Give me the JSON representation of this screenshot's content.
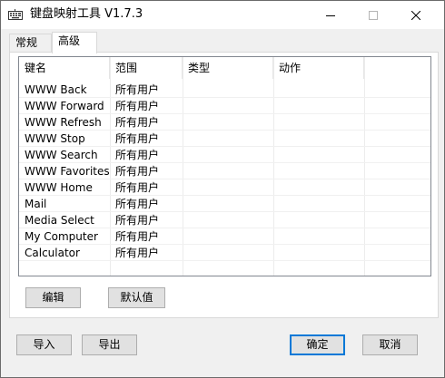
{
  "window": {
    "title": "键盘映射工具 V1.7.3"
  },
  "titlebar": {
    "icons": [
      "keyboard-icon",
      "minimize-icon",
      "maximize-icon",
      "close-icon"
    ]
  },
  "tabs": [
    {
      "label": "常规",
      "active": false
    },
    {
      "label": "高级",
      "active": true
    }
  ],
  "list": {
    "columns": [
      "键名",
      "范围",
      "类型",
      "动作"
    ],
    "rows": [
      {
        "key": "WWW Back",
        "scope": "所有用户",
        "type": "",
        "action": ""
      },
      {
        "key": "WWW Forward",
        "scope": "所有用户",
        "type": "",
        "action": ""
      },
      {
        "key": "WWW Refresh",
        "scope": "所有用户",
        "type": "",
        "action": ""
      },
      {
        "key": "WWW Stop",
        "scope": "所有用户",
        "type": "",
        "action": ""
      },
      {
        "key": "WWW Search",
        "scope": "所有用户",
        "type": "",
        "action": ""
      },
      {
        "key": "WWW Favorites",
        "scope": "所有用户",
        "type": "",
        "action": ""
      },
      {
        "key": "WWW Home",
        "scope": "所有用户",
        "type": "",
        "action": ""
      },
      {
        "key": "Mail",
        "scope": "所有用户",
        "type": "",
        "action": ""
      },
      {
        "key": "Media Select",
        "scope": "所有用户",
        "type": "",
        "action": ""
      },
      {
        "key": "My Computer",
        "scope": "所有用户",
        "type": "",
        "action": ""
      },
      {
        "key": "Calculator",
        "scope": "所有用户",
        "type": "",
        "action": ""
      }
    ]
  },
  "panel_buttons": {
    "edit": "编辑",
    "default": "默认值"
  },
  "footer_buttons": {
    "import": "导入",
    "export": "导出",
    "ok": "确定",
    "cancel": "取消"
  }
}
